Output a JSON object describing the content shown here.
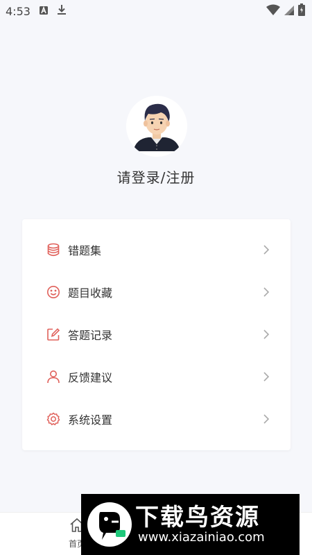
{
  "status_bar": {
    "time": "4:53"
  },
  "profile": {
    "login_text": "请登录/注册"
  },
  "menu": {
    "items": [
      {
        "label": "错题集",
        "icon": "database-icon"
      },
      {
        "label": "题目收藏",
        "icon": "smile-icon"
      },
      {
        "label": "答题记录",
        "icon": "edit-icon"
      },
      {
        "label": "反馈建议",
        "icon": "user-icon"
      },
      {
        "label": "系统设置",
        "icon": "gear-icon"
      }
    ]
  },
  "bottom_nav": {
    "home_label": "首页"
  },
  "watermark": {
    "title": "下载鸟资源",
    "url": "www.xiazainiao.com"
  },
  "colors": {
    "accent": "#e0605a",
    "background": "#f6f7fb",
    "card": "#ffffff"
  }
}
